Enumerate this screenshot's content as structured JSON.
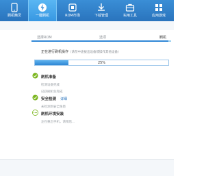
{
  "toolbar": {
    "tabs": [
      {
        "label": "刷机精灵",
        "icon": "phone-icon"
      },
      {
        "label": "一键刷机",
        "icon": "lightning-icon"
      },
      {
        "label": "ROM市场",
        "icon": "rom-chip-icon"
      },
      {
        "label": "下载管理",
        "icon": "download-icon"
      },
      {
        "label": "实用工具",
        "icon": "toolbox-icon"
      },
      {
        "label": "应用游戏",
        "icon": "apps-icon"
      }
    ],
    "active_index": 1
  },
  "steps": {
    "items": [
      "选择ROM",
      "选项",
      "刷机"
    ],
    "active_index": 2
  },
  "status": {
    "main": "正在进行刷机操作",
    "sub": "（请勿中途拔出设备或操作其他设备）"
  },
  "progress": {
    "percent": 25,
    "text": "25%"
  },
  "tasks": [
    {
      "title": "刷机准备",
      "lines": [
        "检测设备完成",
        "已获刷机包完成"
      ],
      "state": "done"
    },
    {
      "title": "安全检测",
      "link": "详细",
      "lines": [
        "未检测到安全隐患"
      ],
      "state": "done"
    },
    {
      "title": "刷机环境安装",
      "lines": [
        "正在重启手机，请稍后..."
      ],
      "state": "in-progress"
    }
  ],
  "colors": {
    "accent": "#2f87d6",
    "check": "#7ab51d",
    "topbar": "#2a74bd"
  }
}
